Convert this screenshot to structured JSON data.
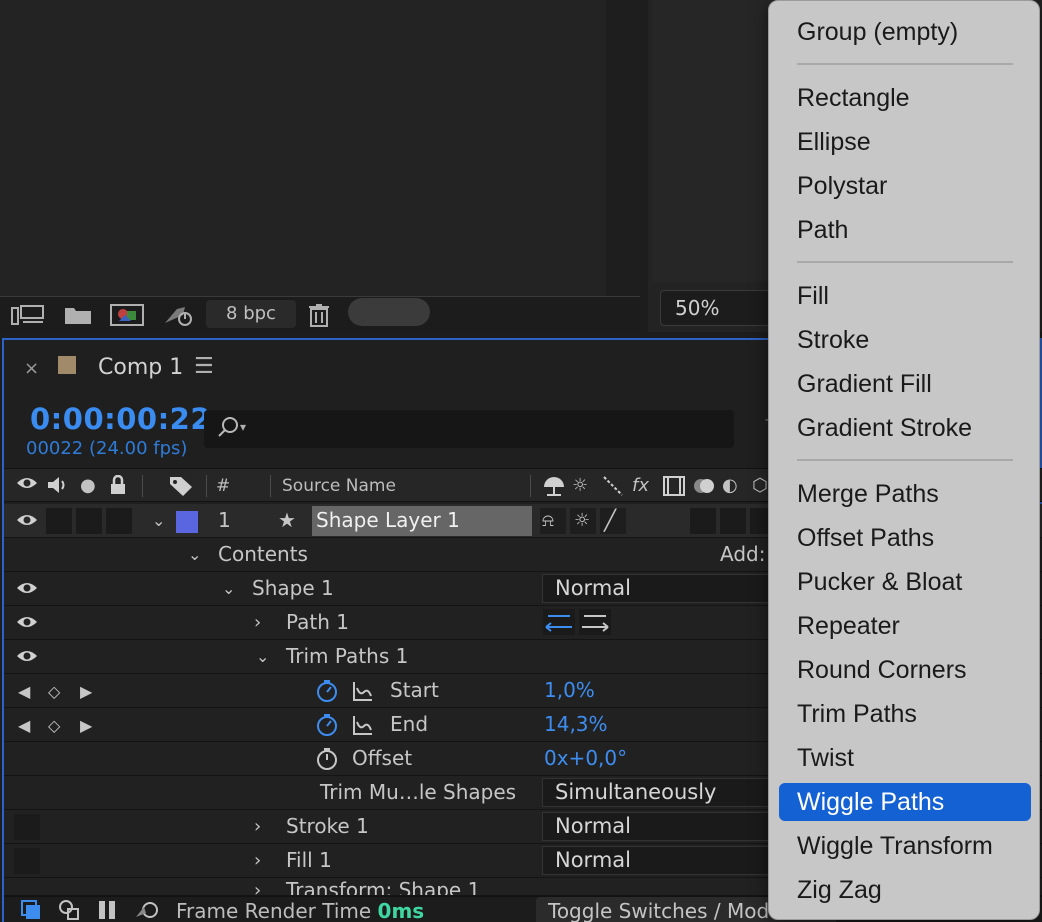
{
  "project": {
    "bpc_label": "8 bpc"
  },
  "viewer": {
    "zoom": "50%"
  },
  "timeline": {
    "comp_tab": "Comp 1",
    "close_glyph": "×",
    "menu_glyph": "☰",
    "timecode": "0:00:00:22",
    "frames": "00022 (24.00 fps)",
    "columns": {
      "number": "#",
      "source_name": "Source Name"
    },
    "layer": {
      "index": "1",
      "name": "Shape Layer 1"
    },
    "contents_label": "Contents",
    "add_label": "Add:",
    "shape1": {
      "label": "Shape 1",
      "mode": "Normal"
    },
    "path1": {
      "label": "Path 1"
    },
    "trim": {
      "label": "Trim Paths 1"
    },
    "start": {
      "label": "Start",
      "value": "1,0%"
    },
    "end": {
      "label": "End",
      "value": "14,3%"
    },
    "offset": {
      "label": "Offset",
      "value": "0x+0,0°"
    },
    "trim_multiple": {
      "label": "Trim Mu…le Shapes",
      "value": "Simultaneously"
    },
    "stroke1": {
      "label": "Stroke 1",
      "mode": "Normal"
    },
    "fill1": {
      "label": "Fill 1",
      "mode": "Normal"
    },
    "transform": {
      "label": "Transform: Shape 1"
    },
    "footer": {
      "render_label": "Frame Render Time",
      "render_value": "0ms",
      "toggle_label": "Toggle Switches / Modes"
    }
  },
  "menu": {
    "items": [
      "Group (empty)",
      "Rectangle",
      "Ellipse",
      "Polystar",
      "Path",
      "Fill",
      "Stroke",
      "Gradient Fill",
      "Gradient Stroke",
      "Merge Paths",
      "Offset Paths",
      "Pucker & Bloat",
      "Repeater",
      "Round Corners",
      "Trim Paths",
      "Twist",
      "Wiggle Paths",
      "Wiggle Transform",
      "Zig Zag"
    ],
    "highlighted": "Wiggle Paths",
    "highlight_color": "#1461d3"
  },
  "colors": {
    "timecode_blue": "#3a8cf0",
    "layer_label": "#5a66e0",
    "panel_focus_border": "#2d63c8",
    "render_time_green": "#3fd6a2"
  }
}
